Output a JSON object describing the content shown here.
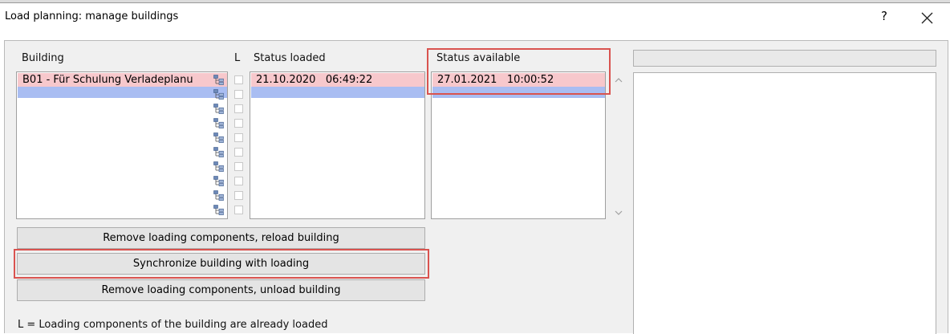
{
  "window": {
    "title": "Load planning: manage buildings",
    "help_label": "?",
    "close_icon": "close-icon"
  },
  "columns": {
    "building": "Building",
    "l": "L",
    "status_loaded": "Status loaded",
    "status_available": "Status available"
  },
  "rows": {
    "building": [
      "B01 - Für Schulung Verladeplanu"
    ],
    "status_loaded": [
      "21.10.2020   06:49:22"
    ],
    "status_available": [
      "27.01.2021   10:00:52"
    ]
  },
  "buttons": {
    "reload": "Remove loading components, reload building",
    "synchronize": "Synchronize building with loading",
    "unload": "Remove loading components, unload building"
  },
  "legend": "L = Loading components of the building are already loaded",
  "colors": {
    "selected_row": "#f7c8cc",
    "focus_row": "#a9bdf2",
    "highlight_frame": "#d9534f"
  }
}
